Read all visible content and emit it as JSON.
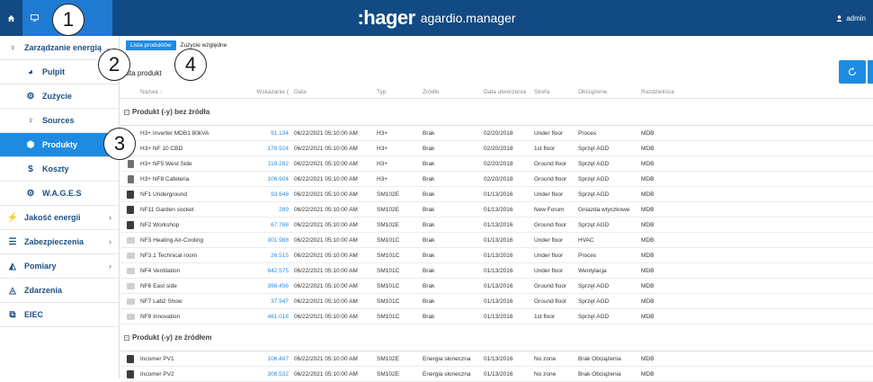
{
  "topbar": {
    "brand_logo": ":hager",
    "brand_app": "agardio.manager",
    "user": "admin"
  },
  "callouts": [
    "1",
    "2",
    "3",
    "4"
  ],
  "sidebar": {
    "items": [
      {
        "label": "Zarządzanie energią",
        "icon": "lightbulb-icon",
        "level": 1,
        "chevron": "⌄"
      },
      {
        "label": "Pulpit",
        "icon": "pie-chart-icon",
        "level": 2
      },
      {
        "label": "Zużycie",
        "icon": "gears-icon",
        "level": 2
      },
      {
        "label": "Sources",
        "icon": "lightbulb-icon",
        "level": 2
      },
      {
        "label": "Produkty",
        "icon": "cube-icon",
        "level": 2,
        "active": true
      },
      {
        "label": "Koszty",
        "icon": "dollar-icon",
        "level": 2
      },
      {
        "label": "W.A.G.E.S",
        "icon": "gears-icon",
        "level": 2
      },
      {
        "label": "Jakość energii",
        "icon": "plug-icon",
        "level": 1,
        "chevron": "›"
      },
      {
        "label": "Zabezpieczenia",
        "icon": "sliders-icon",
        "level": 1,
        "chevron": "›"
      },
      {
        "label": "Pomiary",
        "icon": "area-chart-icon",
        "level": 1,
        "chevron": "›"
      },
      {
        "label": "Zdarzenia",
        "icon": "bell-icon",
        "level": 1
      },
      {
        "label": "EIEC",
        "icon": "sitemap-icon",
        "level": 1
      }
    ]
  },
  "main": {
    "tabs": [
      {
        "label": "Lista produktów",
        "active": true
      },
      {
        "label": "Zużycie względne",
        "active": false
      }
    ],
    "title": "sta produkt",
    "columns": [
      "Nazwa ↑",
      "Wskazanie (",
      "Data",
      "Typ",
      "Źródło",
      "Data utworzenia",
      "Strefa",
      "Obciążenie",
      "Rozdzielnica"
    ],
    "groups": [
      {
        "label": "Produkt (-y) bez źródła",
        "toggle": "⊟",
        "rows": [
          {
            "icon": "none",
            "name": "H3+ Inverter MDB1 80kVA",
            "value": "91.134",
            "date": "06/22/2021 05:10:00 AM",
            "type": "H3+",
            "source": "Brak",
            "created": "02/20/2018",
            "zone": "Under floor",
            "load": "Proces",
            "board": "MDB"
          },
          {
            "icon": "none",
            "name": "H3+ NF 10 CBD",
            "value": "176.924",
            "date": "06/22/2021 05:10:00 AM",
            "type": "H3+",
            "source": "Brak",
            "created": "02/20/2018",
            "zone": "1st floor",
            "load": "Sprzęt AGD",
            "board": "MDB"
          },
          {
            "icon": "mid",
            "name": "H3+ NF5 West Side",
            "value": "119.282",
            "date": "06/22/2021 05:10:00 AM",
            "type": "H3+",
            "source": "Brak",
            "created": "02/20/2018",
            "zone": "Ground floor",
            "load": "Sprzęt AGD",
            "board": "MDB"
          },
          {
            "icon": "mid",
            "name": "H3+ NF8 Cafeteria",
            "value": "106.904",
            "date": "06/22/2021 05:10:00 AM",
            "type": "H3+",
            "source": "Brak",
            "created": "02/20/2018",
            "zone": "Ground floor",
            "load": "Sprzęt AGD",
            "board": "MDB"
          },
          {
            "icon": "dark",
            "name": "NF1 Underground",
            "value": "93.648",
            "date": "06/22/2021 05:10:00 AM",
            "type": "SM102E",
            "source": "Brak",
            "created": "01/13/2016",
            "zone": "Under floor",
            "load": "Sprzęt AGD",
            "board": "MDB"
          },
          {
            "icon": "dark",
            "name": "NF11 Garden socket",
            "value": "289",
            "date": "06/22/2021 05:10:00 AM",
            "type": "SM102E",
            "source": "Brak",
            "created": "01/13/2016",
            "zone": "New Forum",
            "load": "Gniazda wtyczkowe",
            "board": "MDB"
          },
          {
            "icon": "dark",
            "name": "NF2 Workshop",
            "value": "67.768",
            "date": "06/22/2021 05:10:00 AM",
            "type": "SM102E",
            "source": "Brak",
            "created": "01/13/2016",
            "zone": "Ground floor",
            "load": "Sprzęt AGD",
            "board": "MDB"
          },
          {
            "icon": "light",
            "name": "NF3 Heating Air-Cooling",
            "value": "301.988",
            "date": "06/22/2021 05:10:00 AM",
            "type": "SM101C",
            "source": "Brak",
            "created": "01/13/2016",
            "zone": "Under floor",
            "load": "HVAC",
            "board": "MDB"
          },
          {
            "icon": "light",
            "name": "NF3.1 Technical room",
            "value": "26.515",
            "date": "06/22/2021 05:10:00 AM",
            "type": "SM101C",
            "source": "Brak",
            "created": "01/13/2016",
            "zone": "Under floor",
            "load": "Proces",
            "board": "MDB"
          },
          {
            "icon": "light",
            "name": "NF4 Ventilation",
            "value": "642.575",
            "date": "06/22/2021 05:10:00 AM",
            "type": "SM101C",
            "source": "Brak",
            "created": "01/13/2016",
            "zone": "Under floor",
            "load": "Wentylacja",
            "board": "MDB"
          },
          {
            "icon": "light",
            "name": "NF6 East side",
            "value": "398.456",
            "date": "06/22/2021 05:10:00 AM",
            "type": "SM101C",
            "source": "Brak",
            "created": "01/13/2016",
            "zone": "Ground floor",
            "load": "Sprzęt AGD",
            "board": "MDB"
          },
          {
            "icon": "light",
            "name": "NF7 Lab2 Show",
            "value": "37.947",
            "date": "06/22/2021 05:10:00 AM",
            "type": "SM101C",
            "source": "Brak",
            "created": "01/13/2016",
            "zone": "Ground floor",
            "load": "Sprzęt AGD",
            "board": "MDB"
          },
          {
            "icon": "light",
            "name": "NF9 Innovation",
            "value": "461.018",
            "date": "06/22/2021 05:10:00 AM",
            "type": "SM101C",
            "source": "Brak",
            "created": "01/13/2016",
            "zone": "1st floor",
            "load": "Sprzęt AGD",
            "board": "MDB"
          }
        ]
      },
      {
        "label": "Produkt (-y) ze źródłem",
        "toggle": "⊟",
        "rows": [
          {
            "icon": "dark",
            "name": "Incomer PV1",
            "value": "106.497",
            "date": "06/22/2021 05:10:00 AM",
            "type": "SM102E",
            "source": "Energia słoneczna",
            "created": "01/13/2016",
            "zone": "No zone",
            "load": "Brak Obciążenia",
            "board": "MDB"
          },
          {
            "icon": "dark",
            "name": "Incomer PV2",
            "value": "308.532",
            "date": "06/22/2021 05:10:00 AM",
            "type": "SM102E",
            "source": "Energia słoneczna",
            "created": "01/13/2016",
            "zone": "No zone",
            "load": "Brak Obciążenia",
            "board": "MDB"
          }
        ]
      }
    ]
  }
}
